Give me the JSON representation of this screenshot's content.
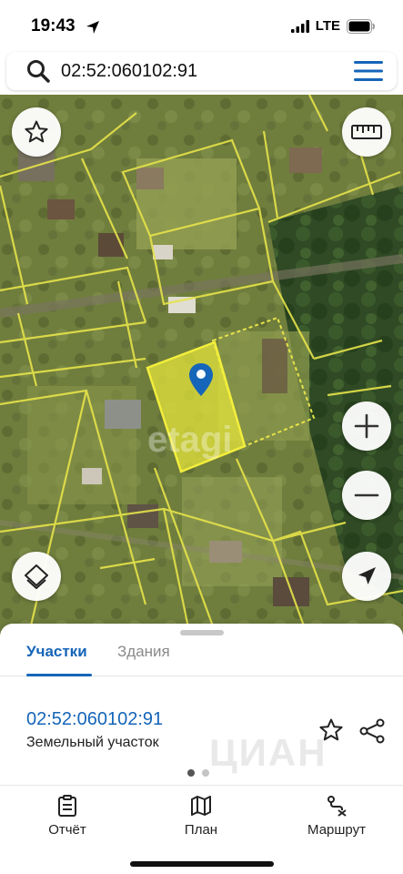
{
  "status_bar": {
    "time": "19:43",
    "network": "LTE"
  },
  "search": {
    "query": "02:52:060102:91"
  },
  "map": {
    "watermark": "etagi",
    "selected_parcel_color": "#e8e83a",
    "boundary_color": "#e6e34a"
  },
  "sheet": {
    "tabs": [
      {
        "label": "Участки",
        "active": true
      },
      {
        "label": "Здания",
        "active": false
      }
    ],
    "parcel": {
      "id": "02:52:060102:91",
      "type": "Земельный участок"
    },
    "page_count": 2,
    "current_page": 1,
    "watermark": "ЦИАН"
  },
  "bottom_nav": {
    "items": [
      {
        "label": "Отчёт",
        "icon": "report-icon"
      },
      {
        "label": "План",
        "icon": "map-plan-icon"
      },
      {
        "label": "Маршрут",
        "icon": "route-icon"
      }
    ]
  },
  "colors": {
    "accent": "#1565b8",
    "parcel_fill": "#e8e83a"
  }
}
